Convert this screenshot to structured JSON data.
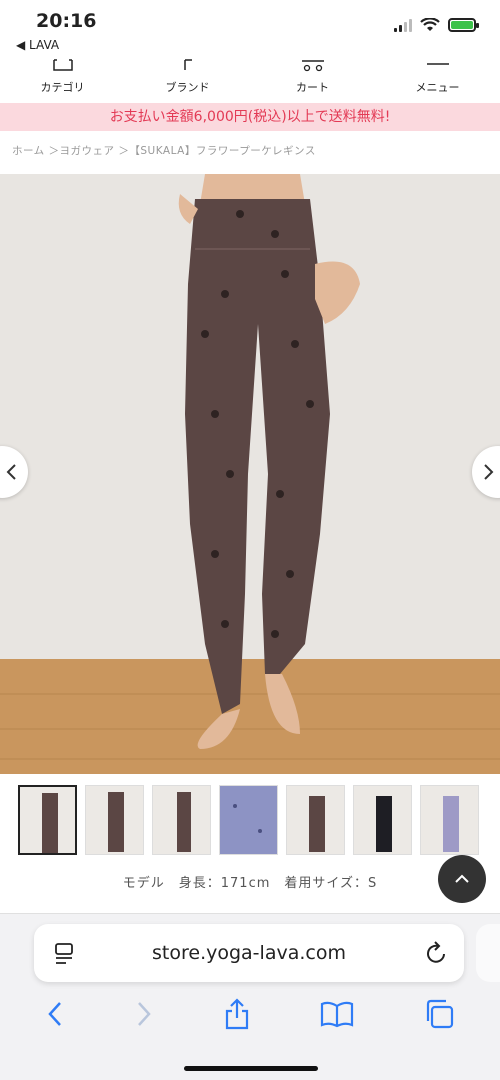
{
  "status_bar": {
    "time": "20:16",
    "back_label": "◀ LAVA"
  },
  "nav": [
    {
      "label": "カテゴリ",
      "icon": "hanger-icon"
    },
    {
      "label": "ブランド",
      "icon": "brand-icon"
    },
    {
      "label": "カート",
      "icon": "cart-icon"
    },
    {
      "label": "メニュー",
      "icon": "menu-icon"
    }
  ],
  "promo": {
    "text": "お支払い金額6,000円(税込)以上で送料無料!"
  },
  "breadcrumb": {
    "text": "ホーム ＞ヨガウェア ＞【SUKALA】フラワープーケレギンス"
  },
  "gallery": {
    "thumbnail_count": 7,
    "selected_index": 0
  },
  "model_info": {
    "text": "モデル　身長：171cm　着用サイズ：S"
  },
  "browser": {
    "url": "store.yoga-lava.com"
  },
  "colors": {
    "accent_pink_bg": "#fbd9de",
    "accent_pink_text": "#e33a55",
    "safari_blue": "#2f7cf6"
  }
}
